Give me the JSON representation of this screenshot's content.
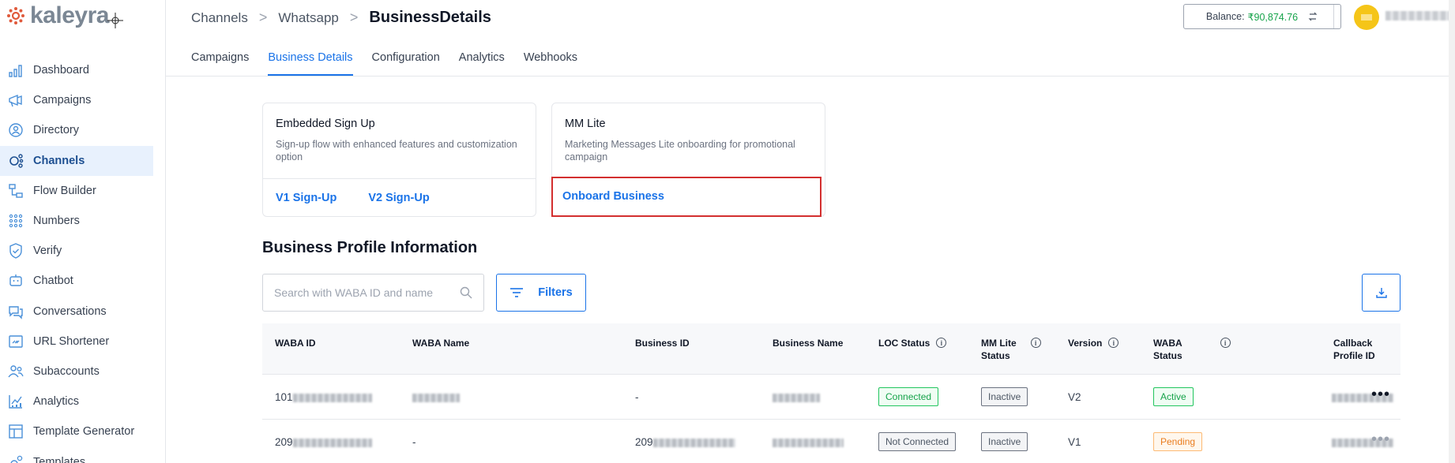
{
  "brand": {
    "logo_text": "kaleyra"
  },
  "sidebar": {
    "items": [
      {
        "label": "Dashboard",
        "icon": "bar-chart-icon"
      },
      {
        "label": "Campaigns",
        "icon": "megaphone-icon"
      },
      {
        "label": "Directory",
        "icon": "contact-icon"
      },
      {
        "label": "Channels",
        "icon": "channels-icon"
      },
      {
        "label": "Flow Builder",
        "icon": "flow-icon"
      },
      {
        "label": "Numbers",
        "icon": "dial-pad-icon"
      },
      {
        "label": "Verify",
        "icon": "shield-check-icon"
      },
      {
        "label": "Chatbot",
        "icon": "bot-icon"
      },
      {
        "label": "Conversations",
        "icon": "chat-bubbles-icon"
      },
      {
        "label": "URL Shortener",
        "icon": "link-icon"
      },
      {
        "label": "Subaccounts",
        "icon": "users-icon"
      },
      {
        "label": "Analytics",
        "icon": "analytics-icon"
      },
      {
        "label": "Template Generator",
        "icon": "template-icon"
      },
      {
        "label": "Templates",
        "icon": "gears-icon"
      }
    ],
    "active": "Channels"
  },
  "breadcrumb": {
    "level1": "Channels",
    "level2": "Whatsapp",
    "current": "BusinessDetails",
    "sep": ">"
  },
  "header": {
    "balance_label": "Balance:",
    "balance_amount": "₹90,874.76"
  },
  "tabs": [
    {
      "label": "Campaigns"
    },
    {
      "label": "Business Details",
      "active": true
    },
    {
      "label": "Configuration"
    },
    {
      "label": "Analytics"
    },
    {
      "label": "Webhooks"
    }
  ],
  "cards": {
    "embedded": {
      "title": "Embedded Sign Up",
      "desc": "Sign-up flow with enhanced features and customization option",
      "link1": "V1 Sign-Up",
      "link2": "V2 Sign-Up"
    },
    "mmlite": {
      "title": "MM Lite",
      "desc": "Marketing Messages Lite onboarding for promotional campaign",
      "link": "Onboard Business"
    }
  },
  "profile": {
    "title": "Business Profile Information",
    "search_placeholder": "Search with WABA ID and name",
    "filters_label": "Filters"
  },
  "table": {
    "headers": {
      "waba_id": "WABA ID",
      "waba_name": "WABA Name",
      "business_id": "Business ID",
      "business_name": "Business Name",
      "loc_status": "LOC Status",
      "mm_lite_1": "MM Lite",
      "mm_lite_2": "Status",
      "version": "Version",
      "waba_status_1": "WABA",
      "waba_status_2": "Status",
      "callback": "Callback Profile ID"
    },
    "rows": [
      {
        "waba_id_prefix": "101",
        "waba_name": "",
        "business_id": "-",
        "business_name": "",
        "loc_status": "Connected",
        "mm_lite_status": "Inactive",
        "version": "V2",
        "waba_status": "Active"
      },
      {
        "waba_id_prefix": "209",
        "waba_name": "-",
        "business_id_prefix": "209",
        "business_name": "",
        "loc_status": "Not Connected",
        "mm_lite_status": "Inactive",
        "version": "V1",
        "waba_status": "Pending"
      }
    ],
    "more_glyph": "•••",
    "info_glyph": "i"
  },
  "colors": {
    "accent": "#1a73e8",
    "highlight": "#d32f2f",
    "active_nav_bg": "#e8f1fd"
  }
}
